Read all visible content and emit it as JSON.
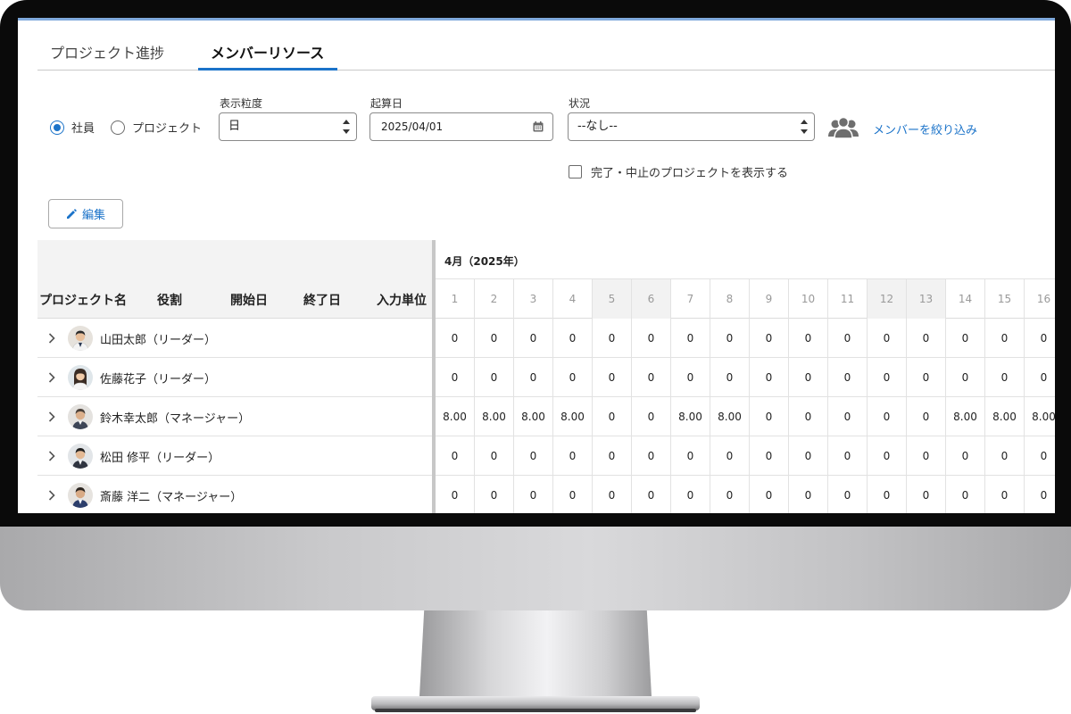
{
  "tabs": [
    {
      "label": "プロジェクト進捗",
      "active": false
    },
    {
      "label": "メンバーリソース",
      "active": true
    }
  ],
  "filters": {
    "view_options": [
      {
        "label": "社員",
        "selected": true
      },
      {
        "label": "プロジェクト",
        "selected": false
      }
    ],
    "granularity": {
      "label": "表示粒度",
      "value": "日"
    },
    "start_date": {
      "label": "起算日",
      "value": "2025/04/01"
    },
    "status": {
      "label": "状況",
      "value": "--なし--"
    },
    "member_filter_label": "メンバーを絞り込み",
    "show_completed_label": "完了・中止のプロジェクトを表示する",
    "show_completed_checked": false
  },
  "toolbar": {
    "edit_label": "編集"
  },
  "grid": {
    "columns": [
      "プロジェクト名",
      "役割",
      "開始日",
      "終了日",
      "入力単位"
    ],
    "month_label": "4月（2025年）",
    "days": [
      "1",
      "2",
      "3",
      "4",
      "5",
      "6",
      "7",
      "8",
      "9",
      "10",
      "11",
      "12",
      "13",
      "14",
      "15",
      "16"
    ],
    "weekend_days": [
      "5",
      "6",
      "12",
      "13"
    ],
    "rows": [
      {
        "name": "山田太郎（リーダー）",
        "values": [
          "0",
          "0",
          "0",
          "0",
          "0",
          "0",
          "0",
          "0",
          "0",
          "0",
          "0",
          "0",
          "0",
          "0",
          "0",
          "0"
        ]
      },
      {
        "name": "佐藤花子（リーダー）",
        "values": [
          "0",
          "0",
          "0",
          "0",
          "0",
          "0",
          "0",
          "0",
          "0",
          "0",
          "0",
          "0",
          "0",
          "0",
          "0",
          "0"
        ]
      },
      {
        "name": "鈴木幸太郎（マネージャー）",
        "values": [
          "8.00",
          "8.00",
          "8.00",
          "8.00",
          "0",
          "0",
          "8.00",
          "8.00",
          "0",
          "0",
          "0",
          "0",
          "0",
          "8.00",
          "8.00",
          "8.00"
        ]
      },
      {
        "name": "松田 修平（リーダー）",
        "values": [
          "0",
          "0",
          "0",
          "0",
          "0",
          "0",
          "0",
          "0",
          "0",
          "0",
          "0",
          "0",
          "0",
          "0",
          "0",
          "0"
        ]
      },
      {
        "name": "斎藤 洋二（マネージャー）",
        "values": [
          "0",
          "0",
          "0",
          "0",
          "0",
          "0",
          "0",
          "0",
          "0",
          "0",
          "0",
          "0",
          "0",
          "0",
          "0",
          "0"
        ]
      }
    ]
  },
  "colors": {
    "accent": "#1b73c9",
    "header_bg": "#f3f3f3",
    "weekend_bg": "#f2f2f2"
  }
}
